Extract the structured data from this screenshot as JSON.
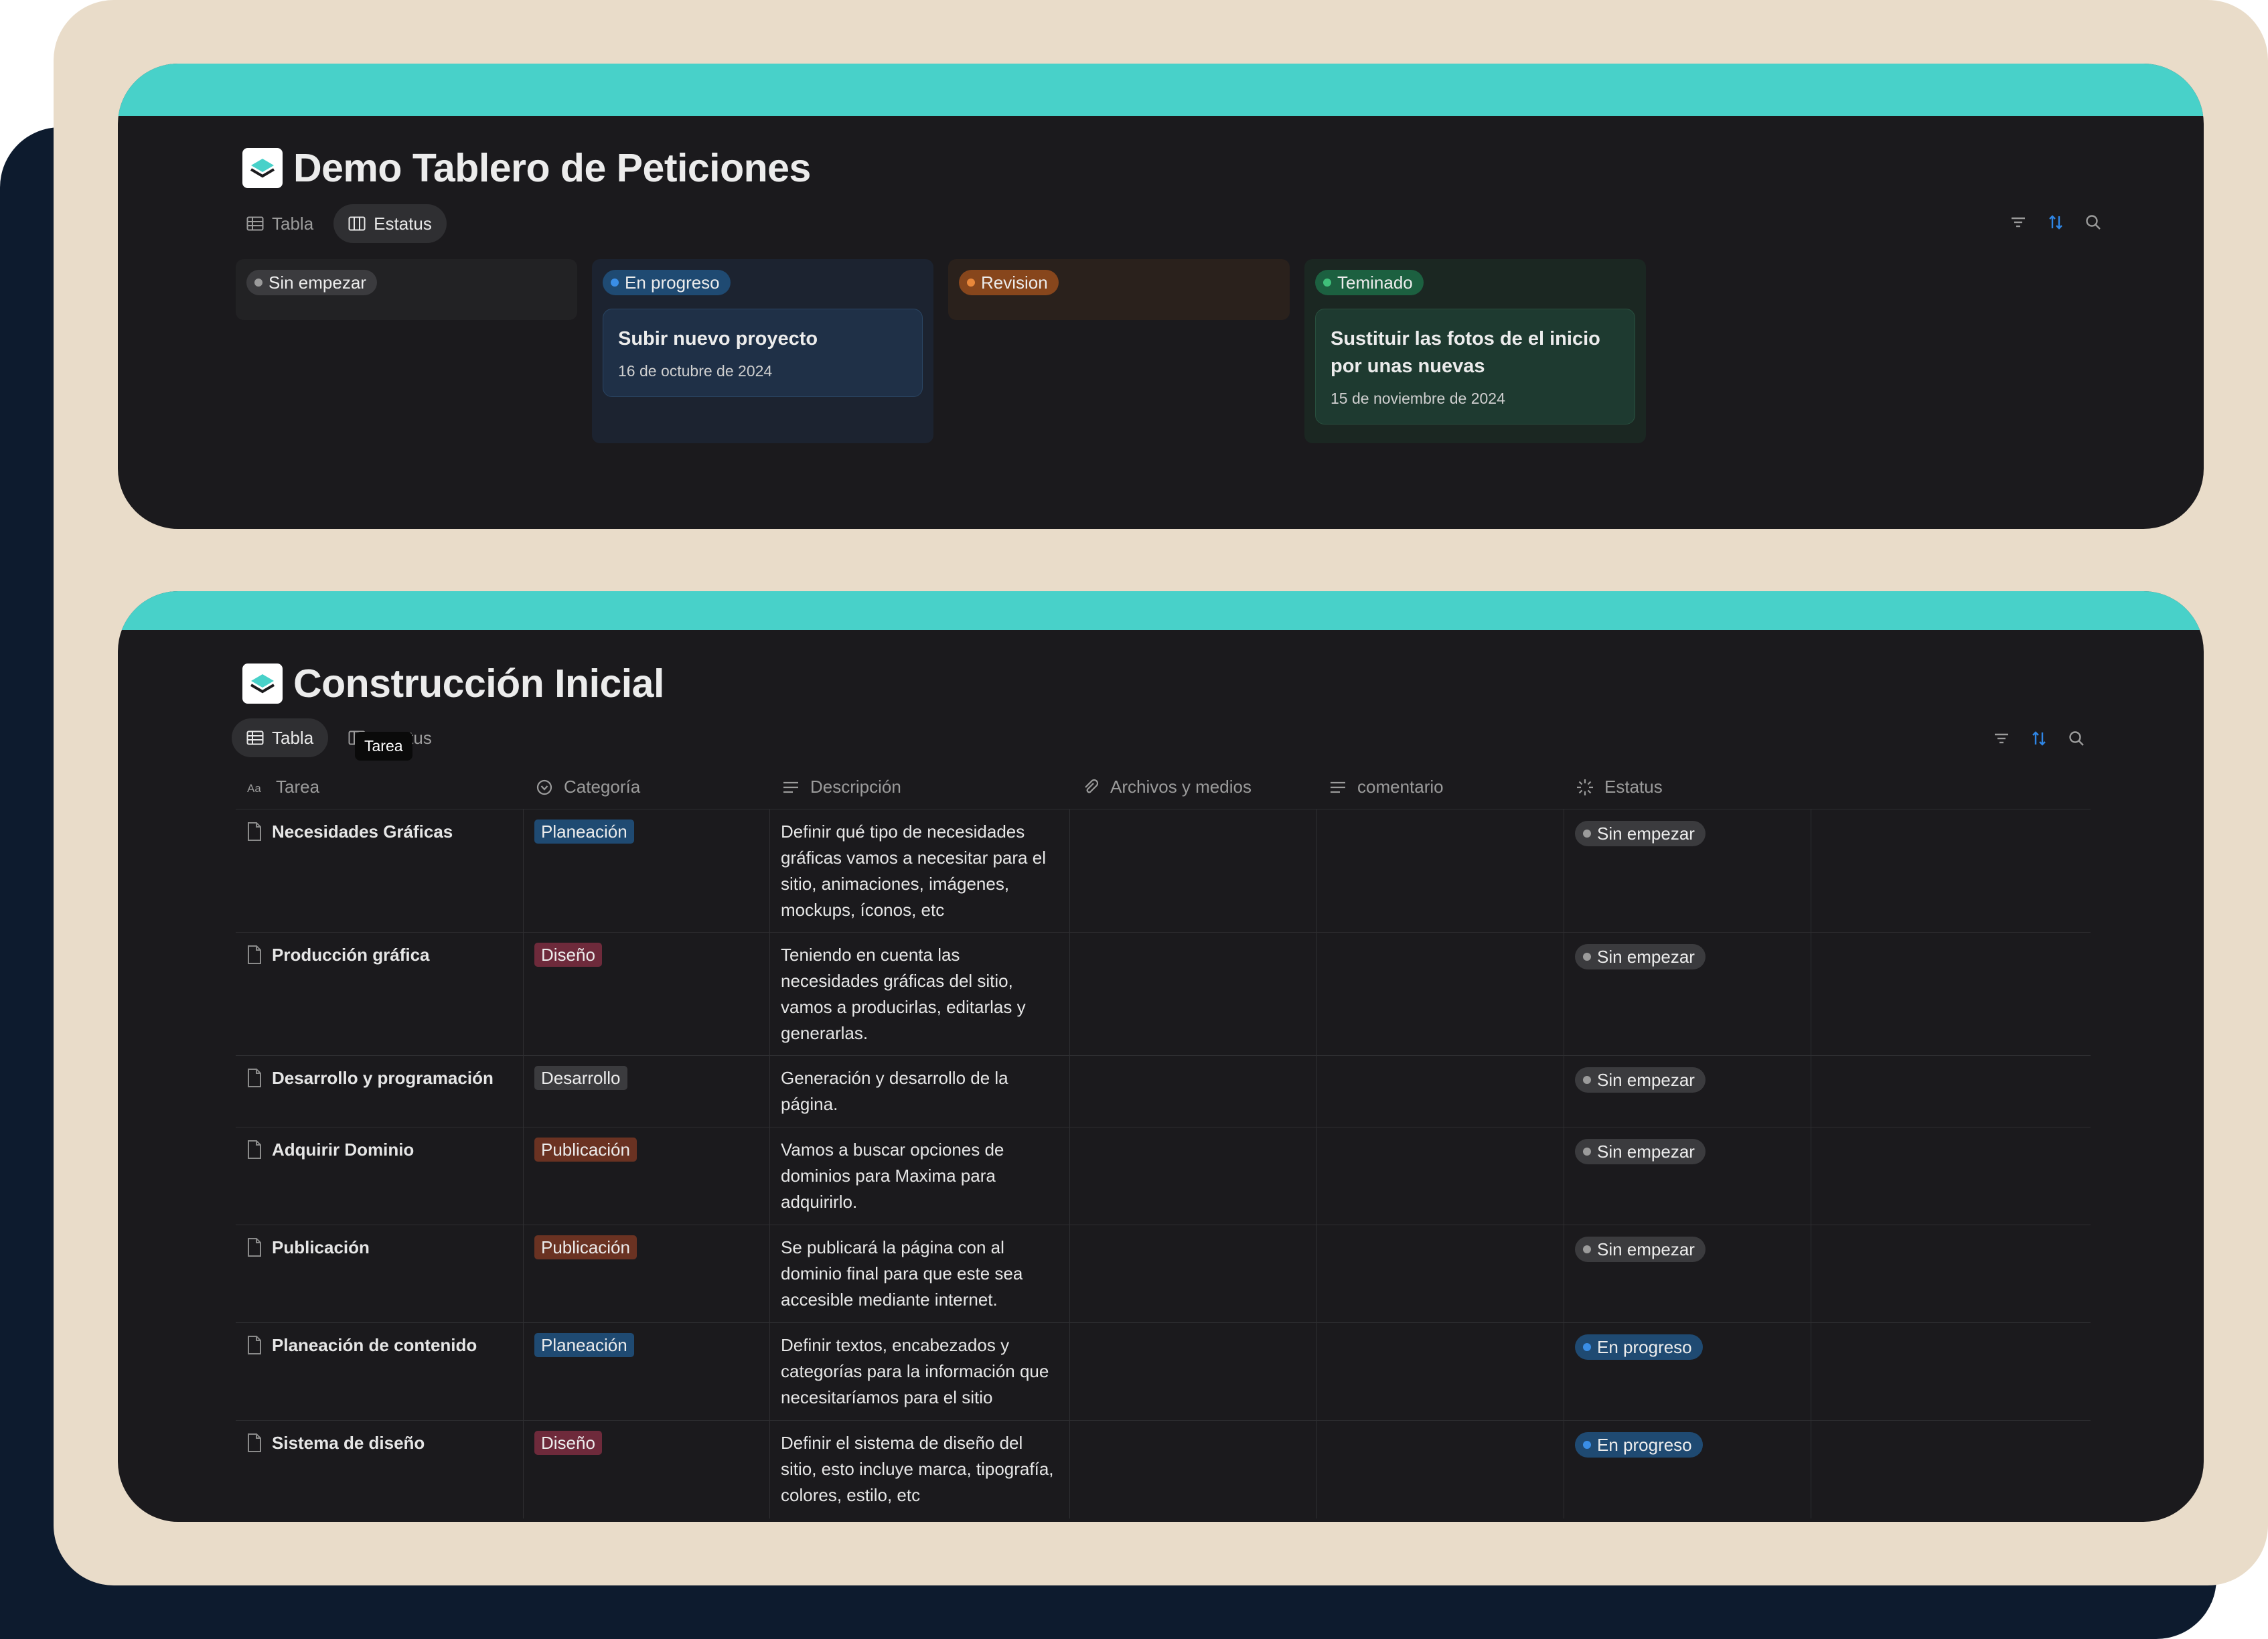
{
  "board_page": {
    "title": "Demo Tablero de Peticiones",
    "icon": "stack-logo-icon",
    "views": [
      {
        "label": "Tabla",
        "icon": "table-icon",
        "active": false
      },
      {
        "label": "Estatus",
        "icon": "board-icon",
        "active": true
      }
    ],
    "columns": [
      {
        "label": "Sin empezar",
        "color": "#3b3b3e",
        "cards": []
      },
      {
        "label": "En progreso",
        "color": "#1f4a72",
        "cards": [
          {
            "title": "Subir nuevo proyecto",
            "date": "16 de octubre de 2024"
          }
        ]
      },
      {
        "label": "Revision",
        "color": "#87461c",
        "cards": []
      },
      {
        "label": "Teminado",
        "color": "#1c6040",
        "cards": [
          {
            "title": "Sustituir las fotos de el inicio por unas nuevas",
            "date": "15 de noviembre de 2024"
          }
        ]
      }
    ]
  },
  "table_page": {
    "title": "Construcción Inicial",
    "icon": "stack-logo-icon",
    "views": [
      {
        "label": "Tabla",
        "icon": "table-icon",
        "active": true
      },
      {
        "label": "Estatus",
        "icon": "board-icon",
        "active": false
      }
    ],
    "tooltip": "Tarea",
    "headers": [
      "Tarea",
      "Categoría",
      "Descripción",
      "Archivos y medios",
      "comentario",
      "Estatus"
    ],
    "rows": [
      {
        "tarea": "Necesidades Gráficas",
        "categoria": "Planeación",
        "descripcion": "Definir qué tipo de necesidades gráficas vamos a necesitar para el sitio, animaciones, imágenes, mockups, íconos, etc",
        "estatus": "Sin empezar"
      },
      {
        "tarea": "Producción gráfica",
        "categoria": "Diseño",
        "descripcion": "Teniendo en cuenta las necesidades gráficas del sitio, vamos a producirlas, editarlas y generarlas.",
        "estatus": "Sin empezar"
      },
      {
        "tarea": "Desarrollo y programación",
        "categoria": "Desarrollo",
        "descripcion": "Generación y desarrollo de la página.",
        "estatus": "Sin empezar"
      },
      {
        "tarea": "Adquirir Dominio",
        "categoria": "Publicación",
        "descripcion": "Vamos a buscar opciones de dominios para Maxima para adquirirlo.",
        "estatus": "Sin empezar"
      },
      {
        "tarea": "Publicación",
        "categoria": "Publicación",
        "descripcion": "Se publicará la página con al dominio final para que este sea accesible mediante internet.",
        "estatus": "Sin empezar"
      },
      {
        "tarea": "Planeación de contenido",
        "categoria": "Planeación",
        "descripcion": "Definir textos, encabezados y categorías para la información que necesitaríamos para el sitio",
        "estatus": "En progreso"
      },
      {
        "tarea": "Sistema de diseño",
        "categoria": "Diseño",
        "descripcion": "Definir el sistema de diseño del sitio, esto incluye marca, tipografía, colores, estilo, etc",
        "estatus": "En progreso"
      }
    ]
  },
  "colors": {
    "teal_band": "#48d1c9",
    "beige_frame": "#e9dcc9",
    "navy_frame": "#0d1b2e",
    "panel_bg": "#1b1a1d"
  }
}
